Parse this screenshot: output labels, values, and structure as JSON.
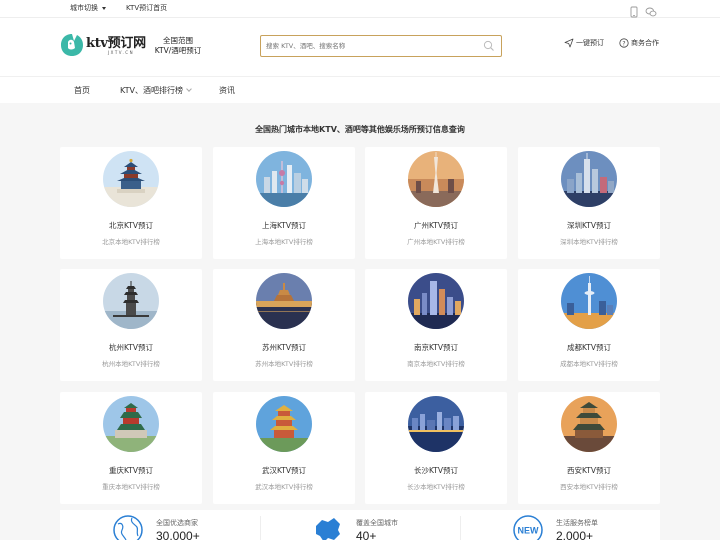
{
  "topbar": {
    "city_switch": "城市切换",
    "home_link": "KTV预订首页",
    "mobile_icon": "mobile-icon",
    "wechat_icon": "wechat-icon"
  },
  "header": {
    "logo_text": "ktv预订网",
    "logo_sub": "JXTV.CN",
    "slogan_line1": "全国范围",
    "slogan_line2": "KTV/酒吧预订",
    "search_placeholder": "搜索 KTV、酒吧、搜索名称",
    "booking_link": "一键预订",
    "business_link": "商务合作"
  },
  "nav": {
    "items": [
      {
        "label": "首页"
      },
      {
        "label": "KTV、酒吧排行榜"
      },
      {
        "label": "资讯"
      }
    ]
  },
  "main": {
    "section_title": "全国热门城市本地KTV、酒吧等其他娱乐场所预订信息查询",
    "cities": [
      {
        "title": "北京KTV预订",
        "subtitle": "北京本地KTV排行榜",
        "photo": "temple-of-heaven"
      },
      {
        "title": "上海KTV预订",
        "subtitle": "上海本地KTV排行榜",
        "photo": "shanghai-skyline"
      },
      {
        "title": "广州KTV预订",
        "subtitle": "广州本地KTV排行榜",
        "photo": "canton-tower"
      },
      {
        "title": "深圳KTV预订",
        "subtitle": "深圳本地KTV排行榜",
        "photo": "shenzhen-skyline"
      },
      {
        "title": "杭州KTV预订",
        "subtitle": "杭州本地KTV排行榜",
        "photo": "west-lake-pagoda"
      },
      {
        "title": "苏州KTV预订",
        "subtitle": "苏州本地KTV排行榜",
        "photo": "suzhou-night"
      },
      {
        "title": "南京KTV预订",
        "subtitle": "南京本地KTV排行榜",
        "photo": "nanjing-night"
      },
      {
        "title": "成都KTV预订",
        "subtitle": "成都本地KTV排行榜",
        "photo": "chengdu-tower"
      },
      {
        "title": "重庆KTV预订",
        "subtitle": "重庆本地KTV排行榜",
        "photo": "chongqing-hall"
      },
      {
        "title": "武汉KTV预订",
        "subtitle": "武汉本地KTV排行榜",
        "photo": "yellow-crane-tower"
      },
      {
        "title": "长沙KTV预订",
        "subtitle": "长沙本地KTV排行榜",
        "photo": "changsha-night"
      },
      {
        "title": "西安KTV预订",
        "subtitle": "西安本地KTV排行榜",
        "photo": "xian-bell-tower"
      }
    ]
  },
  "stats": [
    {
      "label": "全国优选商家",
      "value": "30,000+",
      "icon": "globe-icon"
    },
    {
      "label": "覆盖全国城市",
      "value": "40+",
      "icon": "china-map-icon"
    },
    {
      "label": "生活服务榜单",
      "value": "2,000+",
      "icon": "new-badge-icon"
    }
  ],
  "colors": {
    "accent": "#c8a25c",
    "logo_teal": "#3bb8a8",
    "stat_blue": "#2a7fd4"
  }
}
